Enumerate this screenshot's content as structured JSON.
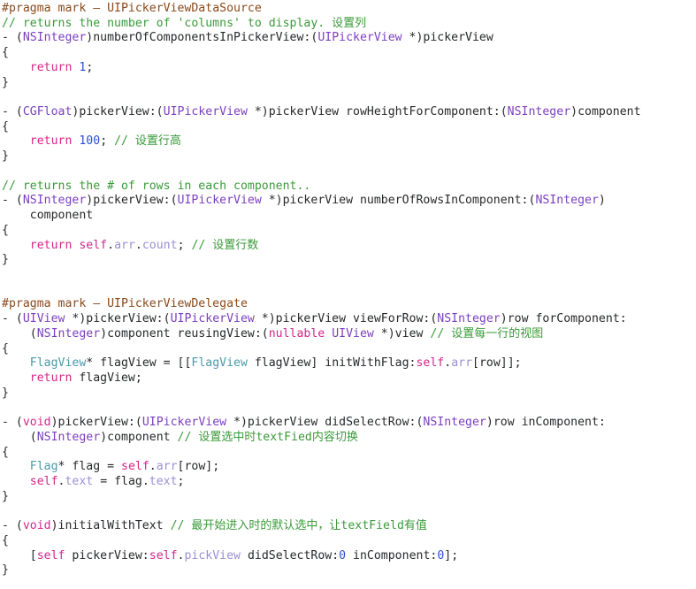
{
  "editor": {
    "background": "#ffffff",
    "default_text_color": "#26282a",
    "language": "Objective-C",
    "font_size_px": 13.2,
    "line_height_px": 16.72
  },
  "palette": {
    "plain": "#26282a",
    "comment": "#3a9a3a",
    "pragma": "#8a4a1a",
    "system_class": "#7b3fbf",
    "keyword": "#d6268a",
    "user_class": "#4c9aa8",
    "property": "#9b8fd4",
    "number": "#2a4fd6"
  },
  "lines": [
    {
      "n": 1,
      "tokens": [
        {
          "t": "#pragma mark ",
          "c": "pragma"
        },
        {
          "t": "— UIPickerViewDataSource",
          "c": "pragma"
        }
      ]
    },
    {
      "n": 2,
      "tokens": [
        {
          "t": "// returns the number of 'columns' to display. ",
          "c": "comment"
        },
        {
          "t": "设置列",
          "c": "comment",
          "cjk": true
        }
      ]
    },
    {
      "n": 3,
      "tokens": [
        {
          "t": "- (",
          "c": "plain"
        },
        {
          "t": "NSInteger",
          "c": "system_class"
        },
        {
          "t": ")numberOfComponentsInPickerView:(",
          "c": "plain"
        },
        {
          "t": "UIPickerView",
          "c": "system_class"
        },
        {
          "t": " *)pickerView",
          "c": "plain"
        }
      ]
    },
    {
      "n": 4,
      "tokens": [
        {
          "t": "{",
          "c": "plain"
        }
      ]
    },
    {
      "n": 5,
      "tokens": [
        {
          "t": "    ",
          "c": "plain"
        },
        {
          "t": "return",
          "c": "keyword"
        },
        {
          "t": " ",
          "c": "plain"
        },
        {
          "t": "1",
          "c": "number"
        },
        {
          "t": ";",
          "c": "plain"
        }
      ]
    },
    {
      "n": 6,
      "tokens": [
        {
          "t": "}",
          "c": "plain"
        }
      ]
    },
    {
      "n": 7,
      "tokens": [
        {
          "t": "",
          "c": "plain"
        }
      ]
    },
    {
      "n": 8,
      "tokens": [
        {
          "t": "- (",
          "c": "plain"
        },
        {
          "t": "CGFloat",
          "c": "system_class"
        },
        {
          "t": ")pickerView:(",
          "c": "plain"
        },
        {
          "t": "UIPickerView",
          "c": "system_class"
        },
        {
          "t": " *)pickerView rowHeightForComponent:(",
          "c": "plain"
        },
        {
          "t": "NSInteger",
          "c": "system_class"
        },
        {
          "t": ")component",
          "c": "plain"
        }
      ]
    },
    {
      "n": 9,
      "tokens": [
        {
          "t": "{",
          "c": "plain"
        }
      ]
    },
    {
      "n": 10,
      "tokens": [
        {
          "t": "    ",
          "c": "plain"
        },
        {
          "t": "return",
          "c": "keyword"
        },
        {
          "t": " ",
          "c": "plain"
        },
        {
          "t": "100",
          "c": "number"
        },
        {
          "t": "; ",
          "c": "plain"
        },
        {
          "t": "// ",
          "c": "comment"
        },
        {
          "t": "设置行高",
          "c": "comment",
          "cjk": true
        }
      ]
    },
    {
      "n": 11,
      "tokens": [
        {
          "t": "}",
          "c": "plain"
        }
      ]
    },
    {
      "n": 12,
      "tokens": [
        {
          "t": "",
          "c": "plain"
        }
      ]
    },
    {
      "n": 13,
      "tokens": [
        {
          "t": "// returns the # of rows in each component..",
          "c": "comment"
        }
      ]
    },
    {
      "n": 14,
      "tokens": [
        {
          "t": "- (",
          "c": "plain"
        },
        {
          "t": "NSInteger",
          "c": "system_class"
        },
        {
          "t": ")pickerView:(",
          "c": "plain"
        },
        {
          "t": "UIPickerView",
          "c": "system_class"
        },
        {
          "t": " *)pickerView numberOfRowsInComponent:(",
          "c": "plain"
        },
        {
          "t": "NSInteger",
          "c": "system_class"
        },
        {
          "t": ")",
          "c": "plain"
        }
      ]
    },
    {
      "n": 15,
      "tokens": [
        {
          "t": "    component",
          "c": "plain"
        }
      ]
    },
    {
      "n": 16,
      "tokens": [
        {
          "t": "{",
          "c": "plain"
        }
      ]
    },
    {
      "n": 17,
      "tokens": [
        {
          "t": "    ",
          "c": "plain"
        },
        {
          "t": "return",
          "c": "keyword"
        },
        {
          "t": " ",
          "c": "plain"
        },
        {
          "t": "self",
          "c": "keyword"
        },
        {
          "t": ".",
          "c": "plain"
        },
        {
          "t": "arr",
          "c": "property"
        },
        {
          "t": ".",
          "c": "plain"
        },
        {
          "t": "count",
          "c": "property"
        },
        {
          "t": "; ",
          "c": "plain"
        },
        {
          "t": "// ",
          "c": "comment"
        },
        {
          "t": "设置行数",
          "c": "comment",
          "cjk": true
        }
      ]
    },
    {
      "n": 18,
      "tokens": [
        {
          "t": "}",
          "c": "plain"
        }
      ]
    },
    {
      "n": 19,
      "tokens": [
        {
          "t": "",
          "c": "plain"
        }
      ]
    },
    {
      "n": 20,
      "tokens": [
        {
          "t": "",
          "c": "plain"
        }
      ]
    },
    {
      "n": 21,
      "tokens": [
        {
          "t": "#pragma mark — UIPickerViewDelegate",
          "c": "pragma"
        }
      ]
    },
    {
      "n": 22,
      "tokens": [
        {
          "t": "- (",
          "c": "plain"
        },
        {
          "t": "UIView",
          "c": "system_class"
        },
        {
          "t": " *)pickerView:(",
          "c": "plain"
        },
        {
          "t": "UIPickerView",
          "c": "system_class"
        },
        {
          "t": " *)pickerView viewForRow:(",
          "c": "plain"
        },
        {
          "t": "NSInteger",
          "c": "system_class"
        },
        {
          "t": ")row forComponent:",
          "c": "plain"
        }
      ]
    },
    {
      "n": 23,
      "tokens": [
        {
          "t": "    (",
          "c": "plain"
        },
        {
          "t": "NSInteger",
          "c": "system_class"
        },
        {
          "t": ")component reusingView:(",
          "c": "plain"
        },
        {
          "t": "nullable",
          "c": "keyword"
        },
        {
          "t": " ",
          "c": "plain"
        },
        {
          "t": "UIView",
          "c": "system_class"
        },
        {
          "t": " *)view ",
          "c": "plain"
        },
        {
          "t": "// ",
          "c": "comment"
        },
        {
          "t": "设置每一行的视图",
          "c": "comment",
          "cjk": true
        }
      ]
    },
    {
      "n": 24,
      "tokens": [
        {
          "t": "{",
          "c": "plain"
        }
      ]
    },
    {
      "n": 25,
      "tokens": [
        {
          "t": "    ",
          "c": "plain"
        },
        {
          "t": "FlagView",
          "c": "user_class"
        },
        {
          "t": "* flagView = [[",
          "c": "plain"
        },
        {
          "t": "FlagView",
          "c": "user_class"
        },
        {
          "t": " flagView] initWithFlag:",
          "c": "plain"
        },
        {
          "t": "self",
          "c": "keyword"
        },
        {
          "t": ".",
          "c": "plain"
        },
        {
          "t": "arr",
          "c": "property"
        },
        {
          "t": "[row]];",
          "c": "plain"
        }
      ]
    },
    {
      "n": 26,
      "tokens": [
        {
          "t": "    ",
          "c": "plain"
        },
        {
          "t": "return",
          "c": "keyword"
        },
        {
          "t": " flagView;",
          "c": "plain"
        }
      ]
    },
    {
      "n": 27,
      "tokens": [
        {
          "t": "}",
          "c": "plain"
        }
      ]
    },
    {
      "n": 28,
      "tokens": [
        {
          "t": "",
          "c": "plain"
        }
      ]
    },
    {
      "n": 29,
      "tokens": [
        {
          "t": "- (",
          "c": "plain"
        },
        {
          "t": "void",
          "c": "keyword"
        },
        {
          "t": ")pickerView:(",
          "c": "plain"
        },
        {
          "t": "UIPickerView",
          "c": "system_class"
        },
        {
          "t": " *)pickerView didSelectRow:(",
          "c": "plain"
        },
        {
          "t": "NSInteger",
          "c": "system_class"
        },
        {
          "t": ")row inComponent:",
          "c": "plain"
        }
      ]
    },
    {
      "n": 30,
      "tokens": [
        {
          "t": "    (",
          "c": "plain"
        },
        {
          "t": "NSInteger",
          "c": "system_class"
        },
        {
          "t": ")component ",
          "c": "plain"
        },
        {
          "t": "// ",
          "c": "comment"
        },
        {
          "t": "设置选中时",
          "c": "comment",
          "cjk": true
        },
        {
          "t": "textFied",
          "c": "comment"
        },
        {
          "t": "内容切换",
          "c": "comment",
          "cjk": true
        }
      ]
    },
    {
      "n": 31,
      "tokens": [
        {
          "t": "{",
          "c": "plain"
        }
      ]
    },
    {
      "n": 32,
      "tokens": [
        {
          "t": "    ",
          "c": "plain"
        },
        {
          "t": "Flag",
          "c": "user_class"
        },
        {
          "t": "* flag = ",
          "c": "plain"
        },
        {
          "t": "self",
          "c": "keyword"
        },
        {
          "t": ".",
          "c": "plain"
        },
        {
          "t": "arr",
          "c": "property"
        },
        {
          "t": "[row];",
          "c": "plain"
        }
      ]
    },
    {
      "n": 33,
      "tokens": [
        {
          "t": "    ",
          "c": "plain"
        },
        {
          "t": "self",
          "c": "keyword"
        },
        {
          "t": ".",
          "c": "plain"
        },
        {
          "t": "text",
          "c": "property"
        },
        {
          "t": " = flag.",
          "c": "plain"
        },
        {
          "t": "text",
          "c": "property"
        },
        {
          "t": ";",
          "c": "plain"
        }
      ]
    },
    {
      "n": 34,
      "tokens": [
        {
          "t": "}",
          "c": "plain"
        }
      ]
    },
    {
      "n": 35,
      "tokens": [
        {
          "t": "",
          "c": "plain"
        }
      ]
    },
    {
      "n": 36,
      "tokens": [
        {
          "t": "- (",
          "c": "plain"
        },
        {
          "t": "void",
          "c": "keyword"
        },
        {
          "t": ")initialWithText ",
          "c": "plain"
        },
        {
          "t": "// ",
          "c": "comment"
        },
        {
          "t": "最开始进入时的默认选中，让",
          "c": "comment",
          "cjk": true
        },
        {
          "t": "textField",
          "c": "comment"
        },
        {
          "t": "有值",
          "c": "comment",
          "cjk": true
        }
      ]
    },
    {
      "n": 37,
      "tokens": [
        {
          "t": "{",
          "c": "plain"
        }
      ]
    },
    {
      "n": 38,
      "tokens": [
        {
          "t": "    [",
          "c": "plain"
        },
        {
          "t": "self",
          "c": "keyword"
        },
        {
          "t": " pickerView:",
          "c": "plain"
        },
        {
          "t": "self",
          "c": "keyword"
        },
        {
          "t": ".",
          "c": "plain"
        },
        {
          "t": "pickView",
          "c": "property"
        },
        {
          "t": " didSelectRow:",
          "c": "plain"
        },
        {
          "t": "0",
          "c": "number"
        },
        {
          "t": " inComponent:",
          "c": "plain"
        },
        {
          "t": "0",
          "c": "number"
        },
        {
          "t": "];",
          "c": "plain"
        }
      ]
    },
    {
      "n": 39,
      "tokens": [
        {
          "t": "}",
          "c": "plain"
        }
      ]
    }
  ]
}
